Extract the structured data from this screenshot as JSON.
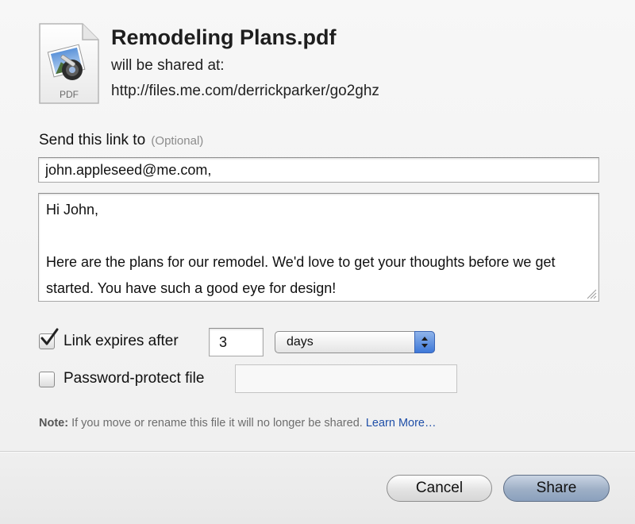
{
  "header": {
    "file_name": "Remodeling Plans.pdf",
    "shared_at_text": "will be shared at:",
    "share_url": "http://files.me.com/derrickparker/go2ghz",
    "file_icon": "pdf-document-icon",
    "file_icon_label": "PDF"
  },
  "send": {
    "label": "Send this link to",
    "optional": "(Optional)",
    "email_value": "john.appleseed@me.com,",
    "message_value": "Hi John,\n\nHere are the plans for our remodel. We'd love to get your thoughts before we get started. You have such a good eye for design!"
  },
  "options": {
    "expires": {
      "checked": true,
      "label": "Link expires after",
      "amount": "3",
      "unit": "days"
    },
    "password": {
      "checked": false,
      "label": "Password-protect file",
      "value": ""
    }
  },
  "note": {
    "prefix": "Note:",
    "text": " If you move or rename this file it will no longer be shared. ",
    "link": "Learn More…"
  },
  "buttons": {
    "cancel": "Cancel",
    "share": "Share"
  },
  "colors": {
    "link": "#1f4fa8",
    "select_stepper": "#3e78d8"
  }
}
